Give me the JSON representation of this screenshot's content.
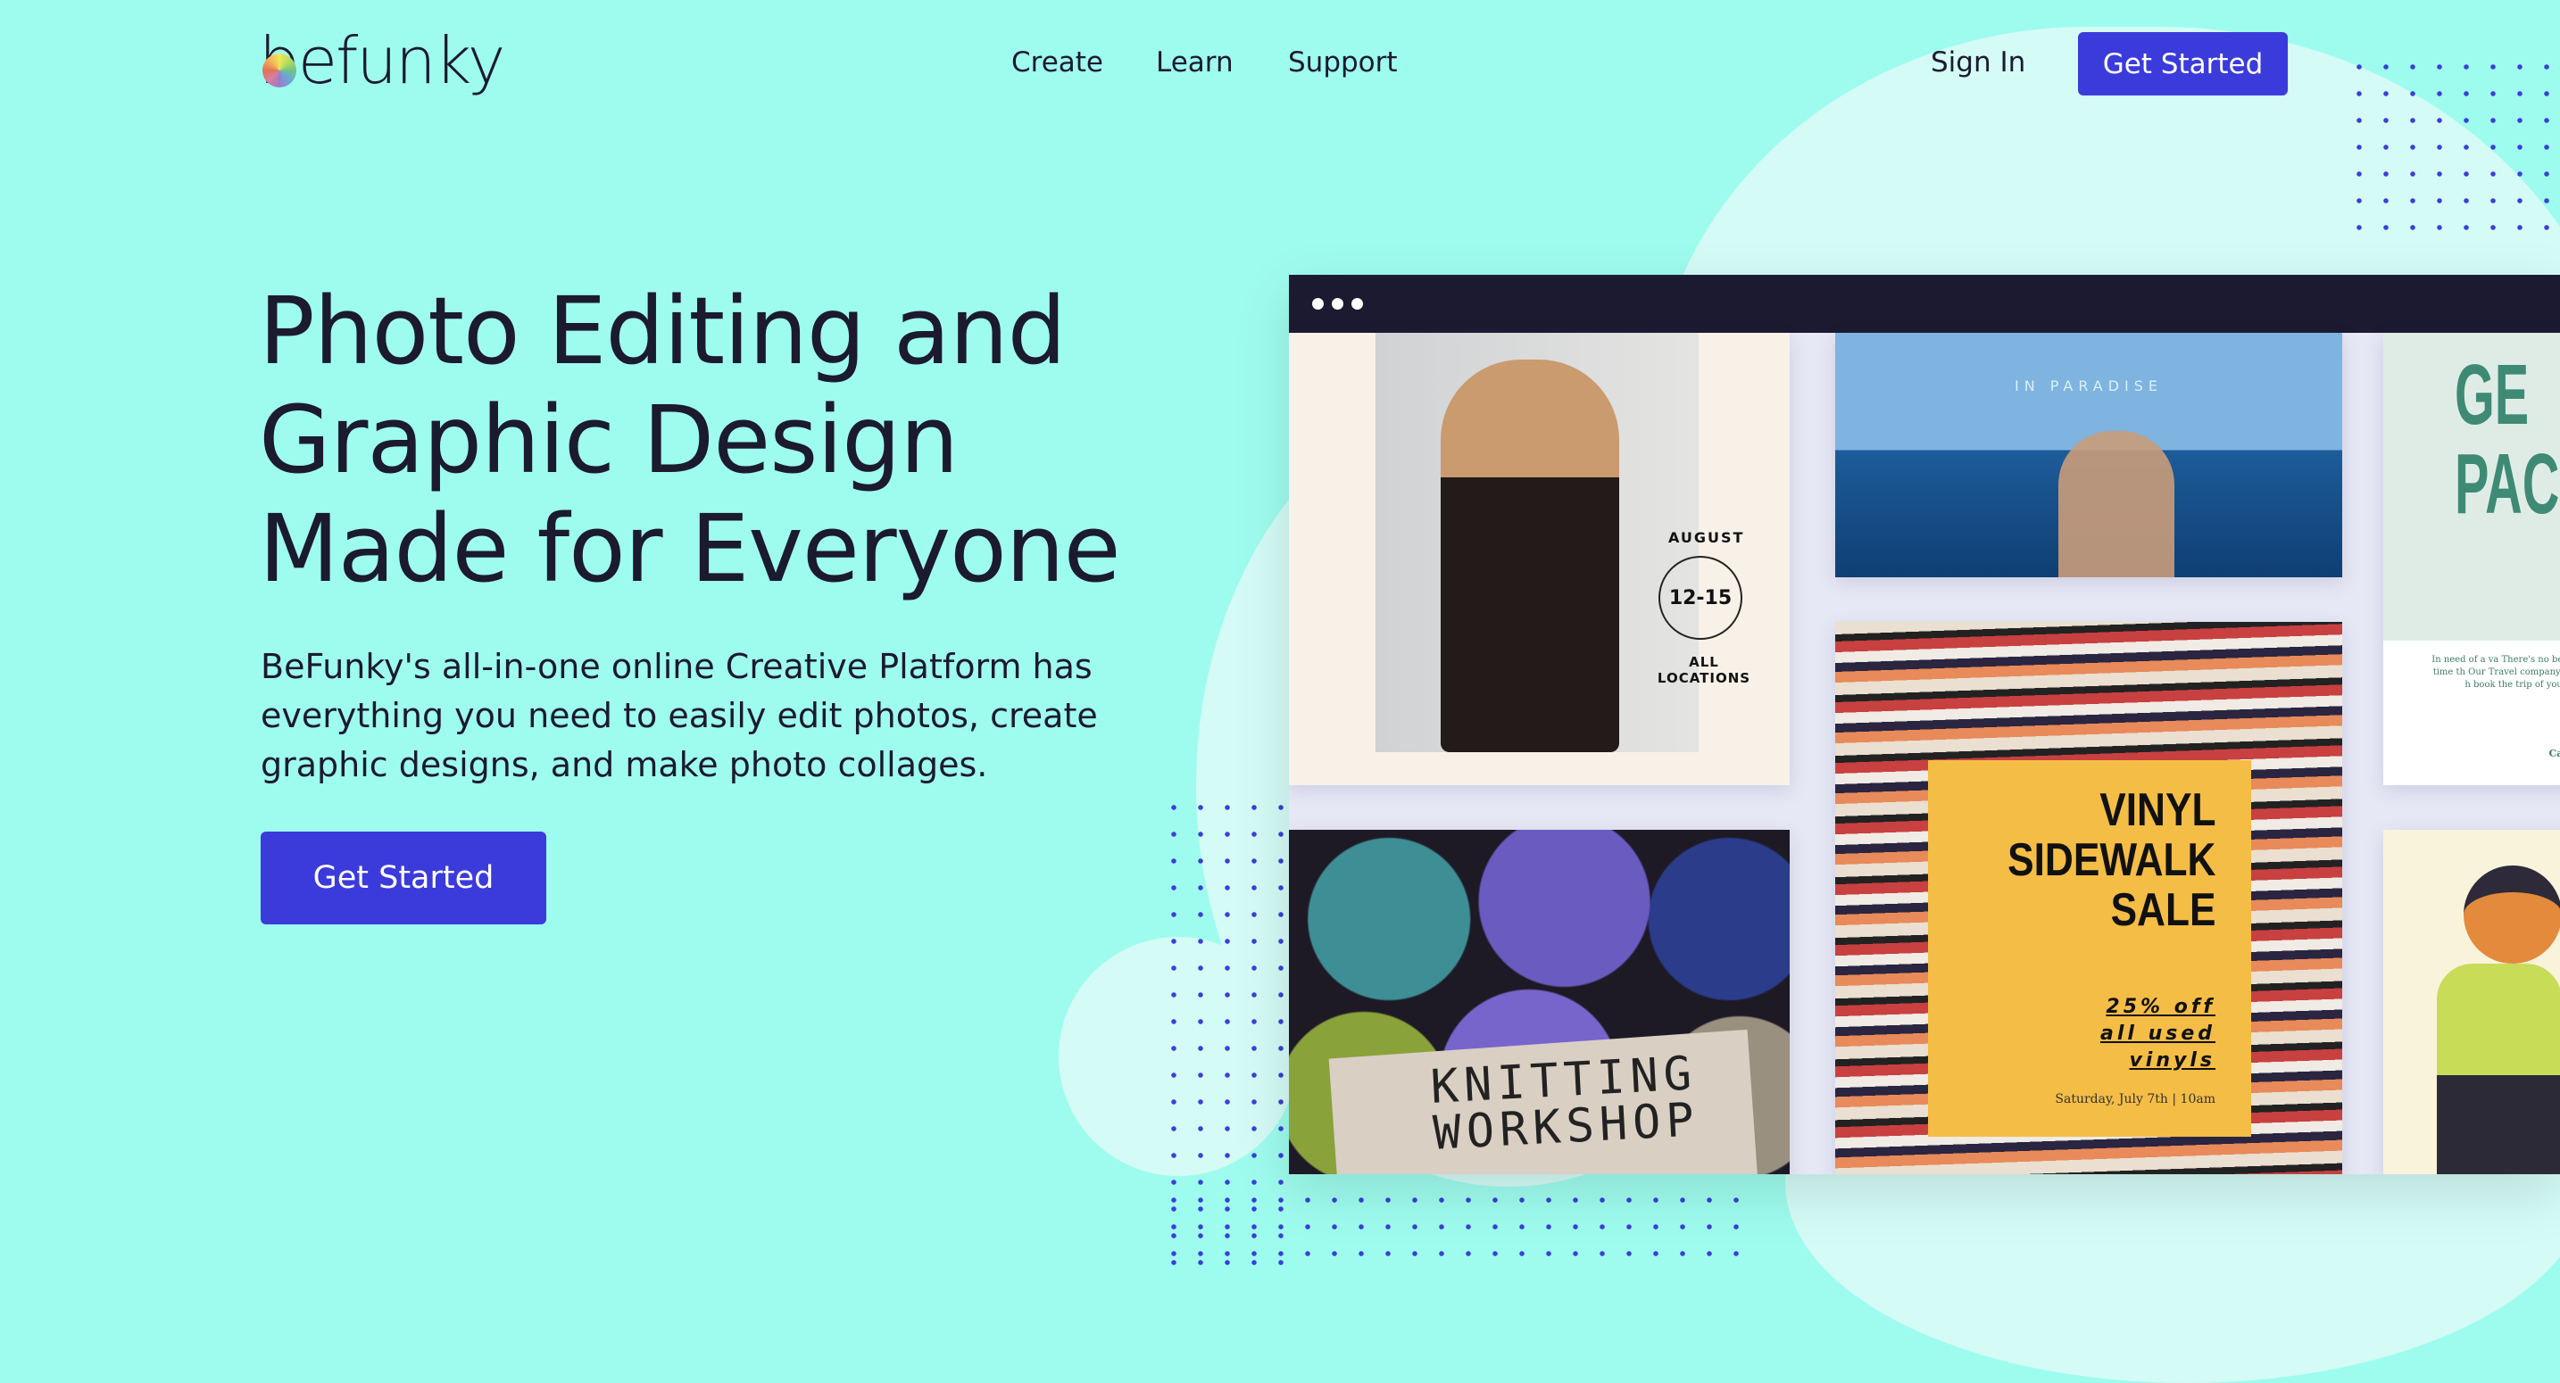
{
  "brand": {
    "logo_text": "befunky"
  },
  "nav": {
    "items": [
      "Create",
      "Learn",
      "Support"
    ],
    "sign_in": "Sign In",
    "get_started": "Get Started"
  },
  "hero": {
    "title_lines": [
      "Photo Editing and",
      "Graphic Design",
      "Made for Everyone"
    ],
    "description": "BeFunky's all-in-one online Creative Platform has everything you need to easily edit photos, create graphic designs, and make photo collages.",
    "cta": "Get Started"
  },
  "showcase": {
    "fashion": {
      "month": "AUGUST",
      "dates": "12-15",
      "locations": "ALL LOCATIONS"
    },
    "travel": {
      "subtitle": "IN PARADISE"
    },
    "poster": {
      "title_letters": "GE PAC",
      "body": "In need of a va There's no better time th Our Travel company will h book the trip of your dr",
      "call": "Call y"
    },
    "knitting": {
      "line1": "KNITTING",
      "line2": "WORKSHOP"
    },
    "vinyl": {
      "title_lines": [
        "VINYL",
        "SIDEWALK",
        "SALE"
      ],
      "offer_lines": [
        "25% off",
        "all used",
        "vinyls"
      ],
      "date": "Saturday, July 7th | 10am"
    }
  },
  "colors": {
    "background": "#9efcee",
    "accent": "#3b3bdc",
    "dark": "#1c1a30",
    "blob": "#d4fbf6"
  }
}
